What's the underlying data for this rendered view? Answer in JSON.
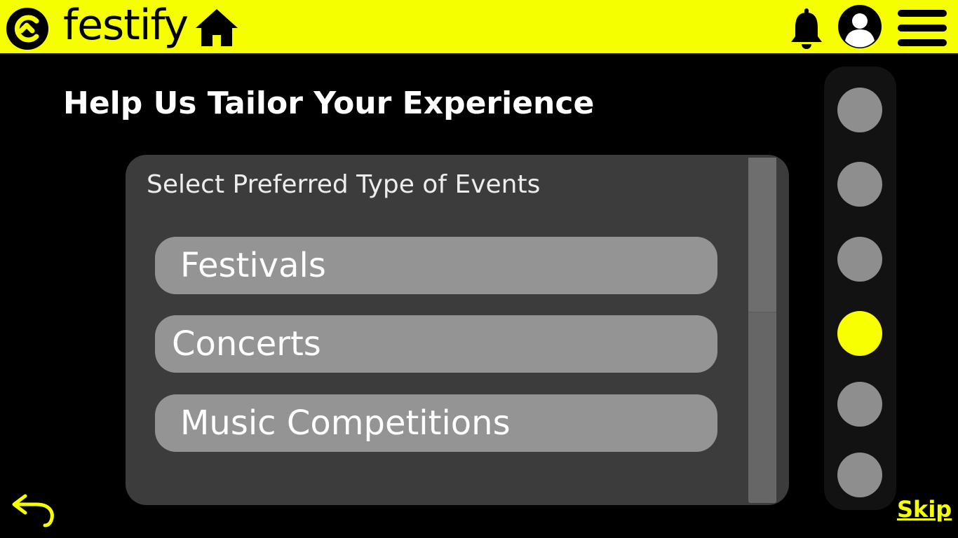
{
  "app": {
    "name": "festify"
  },
  "header": {
    "icons": [
      "logo-icon",
      "home-icon",
      "bell-icon",
      "user-avatar-icon",
      "hamburger-menu-icon"
    ],
    "accent_color": "#f5ff00"
  },
  "main": {
    "title": "Help Us Tailor Your Experience",
    "panel_label": "Select Preferred Type of Events",
    "options": [
      {
        "label": "Festivals"
      },
      {
        "label": "Concerts"
      },
      {
        "label": "Music Competitions"
      }
    ]
  },
  "progress": {
    "total_steps": 6,
    "current_step": 4,
    "active_color": "#f7ff00",
    "inactive_color": "#8e8e8e"
  },
  "footer": {
    "skip_label": "Skip",
    "back_icon": "undo-arrow-icon"
  }
}
